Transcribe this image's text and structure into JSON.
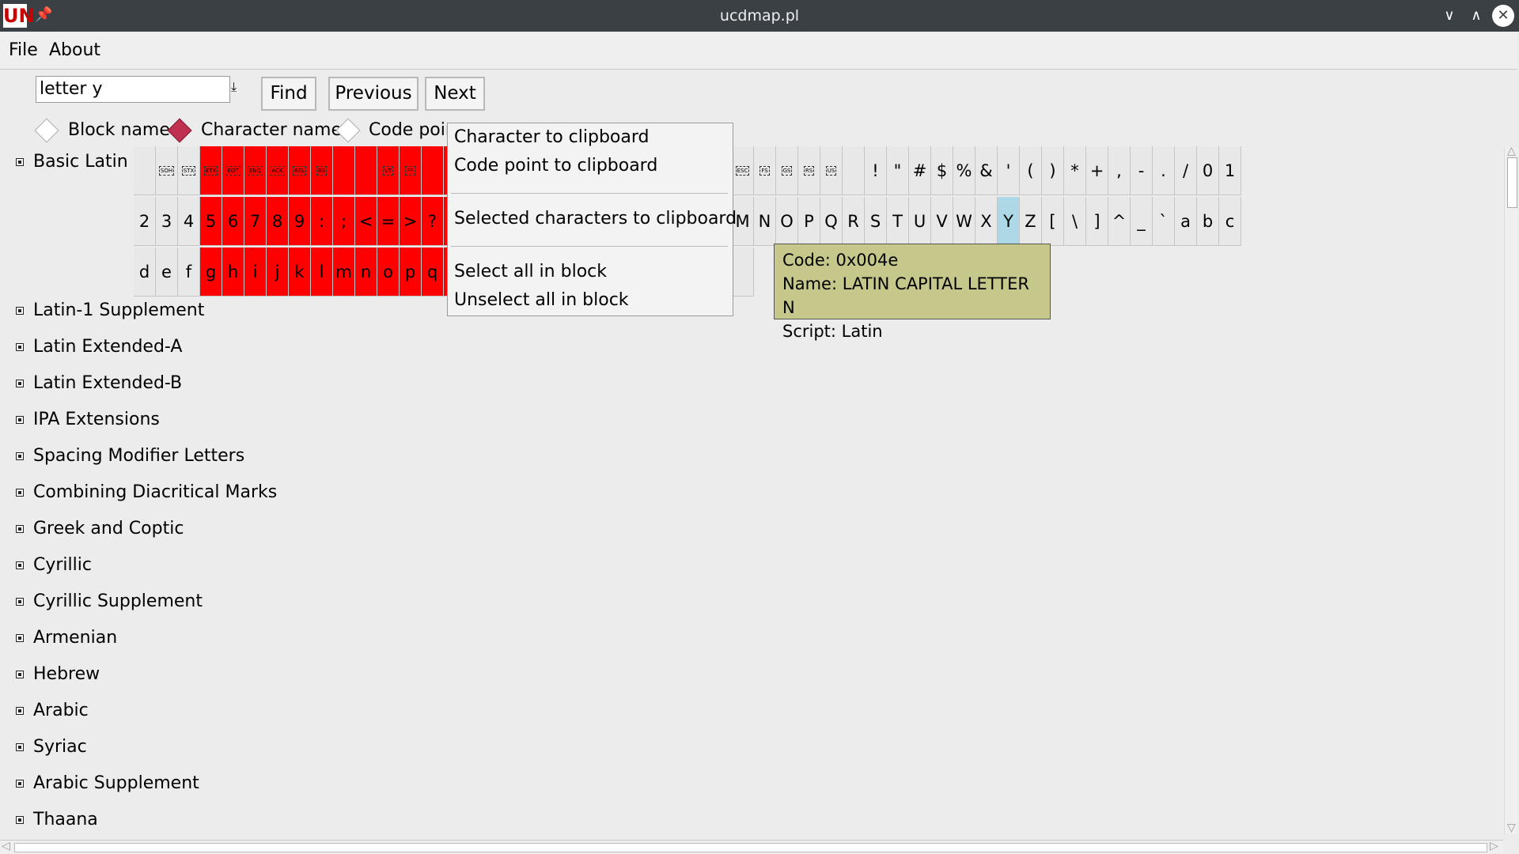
{
  "window": {
    "title": "ucdmap.pl",
    "logo": "UN"
  },
  "menubar": {
    "file": "File",
    "about": "About"
  },
  "search": {
    "value": "letter y",
    "find": "Find",
    "previous": "Previous",
    "next": "Next"
  },
  "search_mode": {
    "block_name": "Block name",
    "character_name": "Character name",
    "code_point": "Code poir",
    "selected": "character_name"
  },
  "blocks": [
    "Basic Latin",
    "Latin-1 Supplement",
    "Latin Extended-A",
    "Latin Extended-B",
    "IPA Extensions",
    "Spacing Modifier Letters",
    "Combining Diacritical Marks",
    "Greek and Coptic",
    "Cyrillic",
    "Cyrillic Supplement",
    "Armenian",
    "Hebrew",
    "Arabic",
    "Syriac",
    "Arabic Supplement",
    "Thaana"
  ],
  "grid": {
    "row1": {
      "cells": [
        "",
        "SOH",
        "STX",
        "ETX",
        "EOT",
        "ENQ",
        "ACK",
        "BEL",
        "BS",
        "",
        "",
        "VT",
        "FF",
        "",
        "",
        "",
        "",
        "",
        "",
        "",
        "",
        "",
        "",
        "",
        "",
        "",
        "",
        "ESC",
        "FS",
        "GS",
        "RS",
        "US",
        "",
        "!",
        "\"",
        "#",
        "$",
        "%",
        "&",
        "'",
        "(",
        ")",
        "*",
        "+",
        ",",
        "-",
        ".",
        "/",
        "0",
        "1"
      ],
      "red": [
        3,
        4,
        5,
        6,
        7,
        8,
        9,
        10,
        11,
        12,
        13,
        14,
        15,
        16,
        17
      ]
    },
    "row2": {
      "cells": [
        "2",
        "3",
        "4",
        "5",
        "6",
        "7",
        "8",
        "9",
        ":",
        ";",
        "<",
        "=",
        ">",
        "?",
        "",
        "",
        "",
        "",
        "",
        "",
        "",
        "",
        "",
        "",
        "",
        "",
        "",
        "M",
        "N",
        "O",
        "P",
        "Q",
        "R",
        "S",
        "T",
        "U",
        "V",
        "W",
        "X",
        "Y",
        "Z",
        "[",
        "\\",
        "]",
        "^",
        "_",
        "`",
        "a",
        "b",
        "c"
      ],
      "red": [
        3,
        4,
        5,
        6,
        7,
        8,
        9,
        10,
        11,
        12,
        13,
        14,
        15,
        16,
        17
      ],
      "selected": [
        39
      ]
    },
    "row3": {
      "cells": [
        "d",
        "e",
        "f",
        "g",
        "h",
        "i",
        "j",
        "k",
        "l",
        "m",
        "n",
        "o",
        "p",
        "q",
        "",
        "",
        "",
        "",
        "",
        "",
        "",
        "",
        "",
        "",
        "",
        "",
        "",
        ""
      ],
      "red": [
        3,
        4,
        5,
        6,
        7,
        8,
        9,
        10,
        11,
        12,
        13,
        14,
        15,
        16,
        17
      ]
    }
  },
  "context_menu": {
    "char_to_clipboard": "Character to clipboard",
    "code_to_clipboard": "Code point to clipboard",
    "selected_to_clipboard": "Selected characters to clipboard",
    "select_all": "Select all in block",
    "unselect_all": "Unselect all in block"
  },
  "tooltip": {
    "code": "Code: 0x004e",
    "name": "Name: LATIN CAPITAL LETTER N",
    "script": "Script: Latin"
  },
  "colors": {
    "titlebar": "#3b4045",
    "selected_range": "#ff0000",
    "highlight": "#add8e6",
    "tooltip": "#c6c78a"
  }
}
